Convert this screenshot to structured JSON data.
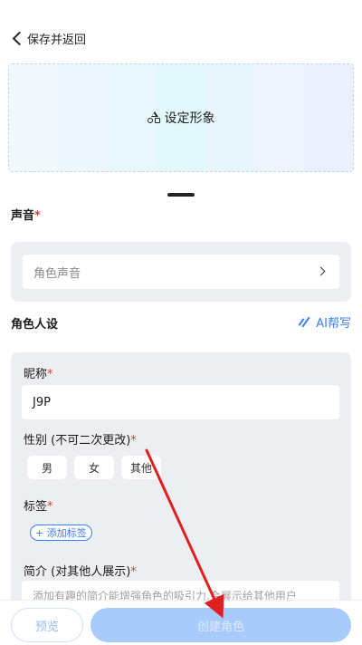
{
  "header": {
    "back_label": "保存并返回"
  },
  "avatar": {
    "label": "设定形象",
    "stripe_colors": [
      "#f2f8fe",
      "#edf7fd",
      "#e8f8fc",
      "#e2f8fb",
      "#e9f5fd",
      "#eff4fe",
      "#ecf0fd"
    ]
  },
  "voice": {
    "section_label": "声音",
    "required_mark": "*",
    "placeholder": "角色声音"
  },
  "persona": {
    "section_label": "角色人设",
    "ai_help": "AI帮写",
    "nickname": {
      "label": "昵称",
      "required_mark": "*",
      "value": "J9P"
    },
    "gender": {
      "label": "性别 (不可二次更改)",
      "required_mark": "*",
      "options": [
        "男",
        "女",
        "其他"
      ]
    },
    "tags": {
      "label": "标签",
      "required_mark": "*",
      "add_label": "+ 添加标签"
    },
    "intro": {
      "label": "简介 (对其他人展示)",
      "required_mark": "*",
      "placeholder": "添加有趣的简介能增强角色的吸引力,会展示给其他用户"
    }
  },
  "bottom": {
    "preview_label": "预览",
    "create_label": "创建角色"
  },
  "colors": {
    "accent": "#3b7ef5",
    "required": "#e53935",
    "card_bg": "#eceef2",
    "annotation_arrow": "#e02020"
  }
}
